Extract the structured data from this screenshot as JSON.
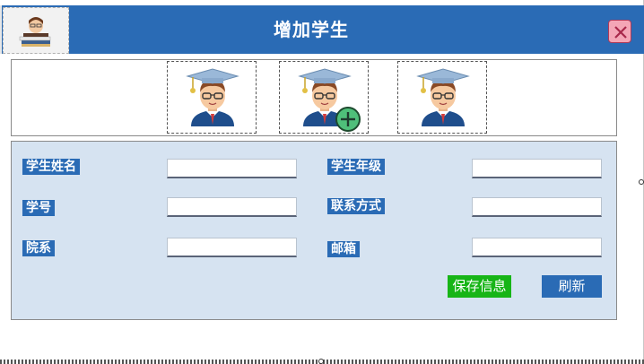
{
  "window": {
    "title": "增加学生"
  },
  "icons": [
    {
      "name": "student-avatar-icon"
    },
    {
      "name": "add-student-icon"
    },
    {
      "name": "student-avatar-icon"
    }
  ],
  "form": {
    "fields": [
      {
        "label": "学生姓名",
        "value": ""
      },
      {
        "label": "学号",
        "value": ""
      },
      {
        "label": "院系",
        "value": ""
      },
      {
        "label": "学生年级",
        "value": ""
      },
      {
        "label": "联系方式",
        "value": ""
      },
      {
        "label": "邮箱",
        "value": ""
      }
    ]
  },
  "buttons": {
    "save_label": "保存信息",
    "refresh_label": "刷新"
  },
  "colors": {
    "titlebar": "#2a6bb5",
    "panel": "#d6e3f1",
    "label_bg": "#2a6bb5",
    "save_btn": "#17b517",
    "refresh_btn": "#2a6bb5",
    "close_btn": "#f4a6b6"
  }
}
